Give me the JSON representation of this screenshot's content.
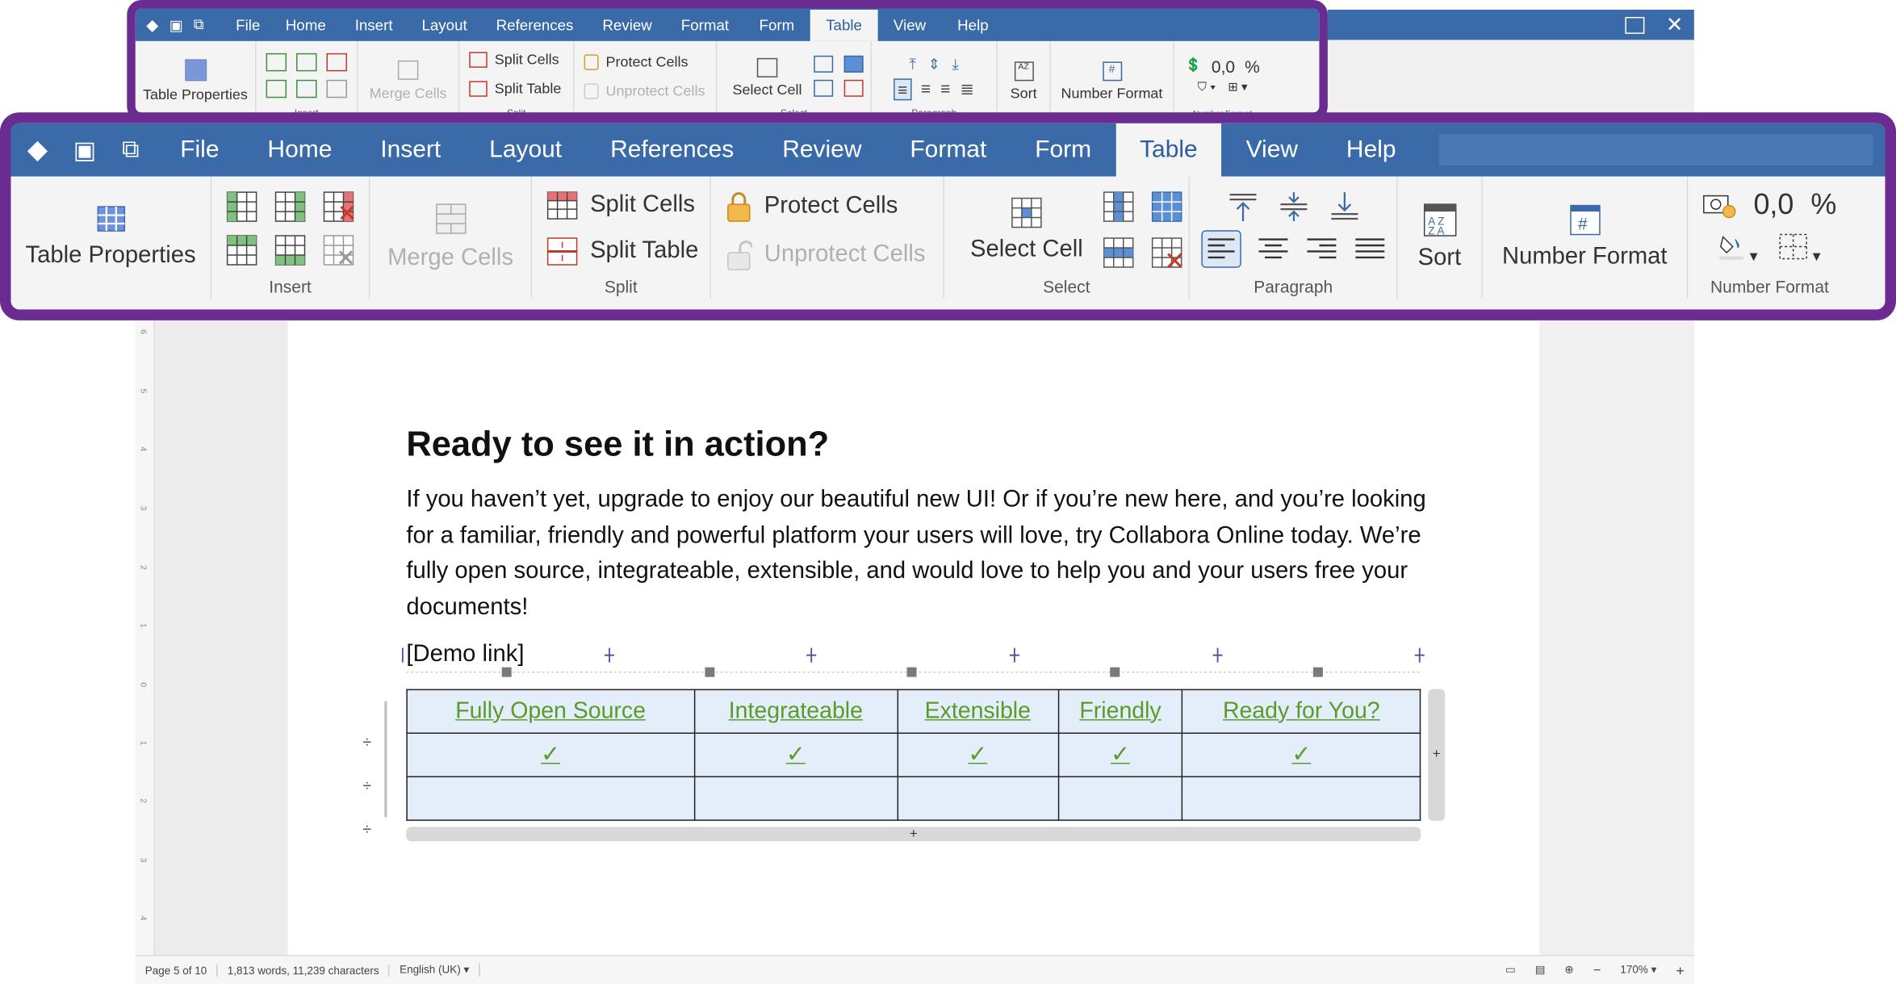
{
  "app": {
    "menu_tabs": [
      "File",
      "Home",
      "Insert",
      "Layout",
      "References",
      "Review",
      "Format",
      "Form",
      "Table",
      "View",
      "Help"
    ],
    "active_tab": "Table"
  },
  "ribbon": {
    "table_properties": "Table Properties",
    "insert_group": "Insert",
    "merge_cells": "Merge Cells",
    "split_cells": "Split Cells",
    "split_table": "Split Table",
    "split_group": "Split",
    "protect_cells": "Protect Cells",
    "unprotect_cells": "Unprotect Cells",
    "select_cell": "Select Cell",
    "select_group": "Select",
    "paragraph_group": "Paragraph",
    "sort": "Sort",
    "number_format": "Number Format",
    "number_format_group": "Number Format",
    "decimal_glyph": "0,0",
    "percent_glyph": "%"
  },
  "document": {
    "heading": "Ready to see it in action?",
    "paragraph": "If you haven’t yet, upgrade to enjoy our beautiful new UI! Or if you’re new here, and you’re looking for a familiar, friendly and powerful platform your users will love, try Collabora Online today. We’re fully open source, integrateable, extensible, and would love to help you and your users free your documents!",
    "demo_link": "[Demo link]",
    "table_headers": [
      "Fully Open Source",
      "Integrateable",
      "Extensible",
      "Friendly",
      "Ready for You?"
    ],
    "check_mark": "✓",
    "row_add": "+"
  },
  "status": {
    "page": "Page 5 of 10",
    "words": "1,813 words, 11,239 characters",
    "language": "English (UK)",
    "zoom": "170%",
    "zoom_minus": "−",
    "zoom_plus": "+"
  },
  "ruler_marks": [
    "6",
    "5",
    "4",
    "3",
    "2",
    "1",
    "0",
    "1",
    "2",
    "3",
    "4"
  ],
  "colors": {
    "menubar": "#3a6aa7",
    "frame": "#6b2c91",
    "check": "#5a9b2a",
    "table_fill": "#e3eefa"
  }
}
